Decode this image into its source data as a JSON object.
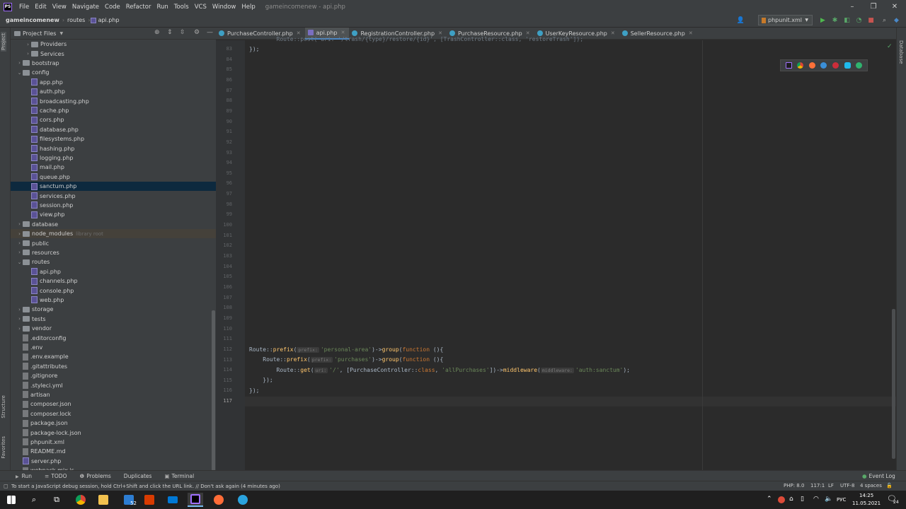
{
  "app": {
    "menu": [
      "File",
      "Edit",
      "View",
      "Navigate",
      "Code",
      "Refactor",
      "Run",
      "Tools",
      "VCS",
      "Window",
      "Help"
    ],
    "window_title": "gameincomenew - api.php",
    "logo_text": "PS"
  },
  "breadcrumb": {
    "project": "gameincomenew",
    "folder": "routes",
    "file": "api.php"
  },
  "run_config": {
    "label": "phpunit.xml",
    "arrow": "▼"
  },
  "project_panel": {
    "title": "Project Files",
    "tree": [
      {
        "label": "Providers",
        "type": "folder",
        "depth": 2,
        "expanded": false,
        "arrow": "›"
      },
      {
        "label": "Services",
        "type": "folder",
        "depth": 2,
        "expanded": false,
        "arrow": "›"
      },
      {
        "label": "bootstrap",
        "type": "folder",
        "depth": 1,
        "expanded": false,
        "arrow": "›"
      },
      {
        "label": "config",
        "type": "folder",
        "depth": 1,
        "expanded": true,
        "arrow": "⌄"
      },
      {
        "label": "app.php",
        "type": "php",
        "depth": 2
      },
      {
        "label": "auth.php",
        "type": "php",
        "depth": 2
      },
      {
        "label": "broadcasting.php",
        "type": "php",
        "depth": 2
      },
      {
        "label": "cache.php",
        "type": "php",
        "depth": 2
      },
      {
        "label": "cors.php",
        "type": "php",
        "depth": 2
      },
      {
        "label": "database.php",
        "type": "php",
        "depth": 2
      },
      {
        "label": "filesystems.php",
        "type": "php",
        "depth": 2
      },
      {
        "label": "hashing.php",
        "type": "php",
        "depth": 2
      },
      {
        "label": "logging.php",
        "type": "php",
        "depth": 2
      },
      {
        "label": "mail.php",
        "type": "php",
        "depth": 2
      },
      {
        "label": "queue.php",
        "type": "php",
        "depth": 2
      },
      {
        "label": "sanctum.php",
        "type": "php",
        "depth": 2,
        "selected": true
      },
      {
        "label": "services.php",
        "type": "php",
        "depth": 2
      },
      {
        "label": "session.php",
        "type": "php",
        "depth": 2
      },
      {
        "label": "view.php",
        "type": "php",
        "depth": 2
      },
      {
        "label": "database",
        "type": "folder",
        "depth": 1,
        "expanded": false,
        "arrow": "›"
      },
      {
        "label": "node_modules",
        "type": "folder",
        "depth": 1,
        "expanded": false,
        "arrow": "›",
        "lib": "library root"
      },
      {
        "label": "public",
        "type": "folder",
        "depth": 1,
        "expanded": false,
        "arrow": "›"
      },
      {
        "label": "resources",
        "type": "folder",
        "depth": 1,
        "expanded": false,
        "arrow": "›"
      },
      {
        "label": "routes",
        "type": "folder",
        "depth": 1,
        "expanded": true,
        "arrow": "⌄"
      },
      {
        "label": "api.php",
        "type": "php",
        "depth": 2
      },
      {
        "label": "channels.php",
        "type": "php",
        "depth": 2
      },
      {
        "label": "console.php",
        "type": "php",
        "depth": 2
      },
      {
        "label": "web.php",
        "type": "php",
        "depth": 2
      },
      {
        "label": "storage",
        "type": "folder",
        "depth": 1,
        "expanded": false,
        "arrow": "›"
      },
      {
        "label": "tests",
        "type": "folder",
        "depth": 1,
        "expanded": false,
        "arrow": "›"
      },
      {
        "label": "vendor",
        "type": "folder",
        "depth": 1,
        "expanded": false,
        "arrow": "›"
      },
      {
        "label": ".editorconfig",
        "type": "file",
        "depth": 1
      },
      {
        "label": ".env",
        "type": "file",
        "depth": 1
      },
      {
        "label": ".env.example",
        "type": "file",
        "depth": 1
      },
      {
        "label": ".gitattributes",
        "type": "file",
        "depth": 1
      },
      {
        "label": ".gitignore",
        "type": "file",
        "depth": 1
      },
      {
        "label": ".styleci.yml",
        "type": "file",
        "depth": 1
      },
      {
        "label": "artisan",
        "type": "file",
        "depth": 1
      },
      {
        "label": "composer.json",
        "type": "file",
        "depth": 1
      },
      {
        "label": "composer.lock",
        "type": "file",
        "depth": 1
      },
      {
        "label": "package.json",
        "type": "file",
        "depth": 1
      },
      {
        "label": "package-lock.json",
        "type": "file",
        "depth": 1
      },
      {
        "label": "phpunit.xml",
        "type": "file",
        "depth": 1
      },
      {
        "label": "README.md",
        "type": "file",
        "depth": 1
      },
      {
        "label": "server.php",
        "type": "php",
        "depth": 1
      },
      {
        "label": "webpack.mix.js",
        "type": "file",
        "depth": 1
      }
    ]
  },
  "side_labels": {
    "project": "Project",
    "structure": "Structure",
    "favorites": "Favorites",
    "database": "Database"
  },
  "tabs": [
    {
      "label": "PurchaseController.php",
      "active": false
    },
    {
      "label": "api.php",
      "active": true
    },
    {
      "label": "RegistrationController.php",
      "active": false
    },
    {
      "label": "PurchaseResource.php",
      "active": false
    },
    {
      "label": "UserKeyResource.php",
      "active": false
    },
    {
      "label": "SellerResource.php",
      "active": false
    }
  ],
  "editor": {
    "top_line_partial": "        Route::post( uri: '/trash/{type}/restore/{id}', [TrashController::class, 'restoreTrash']);",
    "line_numbers": [
      "83",
      "84",
      "85",
      "86",
      "87",
      "88",
      "89",
      "90",
      "91",
      "92",
      "93",
      "94",
      "95",
      "96",
      "97",
      "98",
      "99",
      "100",
      "101",
      "102",
      "103",
      "104",
      "105",
      "106",
      "107",
      "108",
      "109",
      "110",
      "111",
      "112",
      "113",
      "114",
      "115",
      "116",
      "117"
    ],
    "current_line": "117",
    "line_83": "});",
    "line_112": {
      "a": "Route::",
      "b": "prefix",
      "c": "(",
      "hint": "prefix:",
      "s": "'personal-area'",
      "d": ")->",
      "e": "group",
      "f": "(",
      "g": "function",
      "h": " (){"
    },
    "line_113": {
      "a": "    Route::",
      "b": "prefix",
      "c": "(",
      "hint": "prefix:",
      "s": "'purchases'",
      "d": ")->",
      "e": "group",
      "f": "(",
      "g": "function",
      "h": " (){"
    },
    "line_114": {
      "a": "        Route::",
      "b": "get",
      "c": "(",
      "hint": "uri:",
      "s": "'/'",
      "d": ", [PurchaseController::",
      "e": "class",
      "f": ", ",
      "s2": "'allPurchases'",
      "g": "])->",
      "h": "middleware",
      "i": "(",
      "hint2": "middleware:",
      "s3": "'auth:sanctum'",
      "j": ");"
    },
    "line_115": "    });",
    "line_116": "});"
  },
  "toolwindows": [
    "Run",
    "TODO",
    "Problems",
    "Duplicates",
    "Terminal"
  ],
  "event_log": "Event Log",
  "status": {
    "message": "To start a JavaScript debug session, hold Ctrl+Shift and click the URL link. // Don't ask again (4 minutes ago)",
    "php": "PHP: 8.0",
    "position": "117:1",
    "line_sep": "LF",
    "encoding": "UTF-8",
    "indent": "4 spaces"
  },
  "taskbar": {
    "badge": "52",
    "lang": "РУС",
    "time": "14:25",
    "date": "11.05.2021",
    "notif": "24"
  },
  "colors": {
    "accent": "#4a88c7",
    "selection": "#0d293e",
    "keyword": "#cc7832",
    "string": "#6a8759",
    "function": "#ffc66d"
  }
}
